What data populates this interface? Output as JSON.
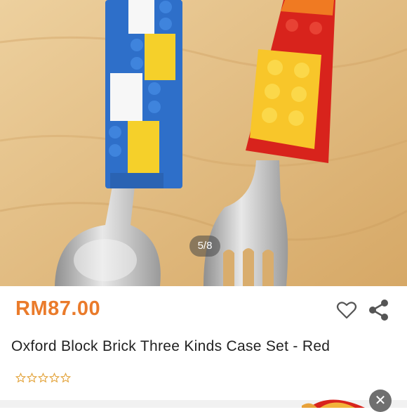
{
  "gallery": {
    "pager_text": "5/8"
  },
  "product": {
    "price": "RM87.00",
    "title": "Oxford Block Brick Three Kinds Case Set - Red",
    "rating_stars": 0,
    "rating_max": 5
  },
  "icons": {
    "favorite": "heart-outline-icon",
    "share": "share-icon",
    "close": "close-icon"
  },
  "colors": {
    "price": "#ea7b2b",
    "star_outline": "#e3a33a"
  }
}
